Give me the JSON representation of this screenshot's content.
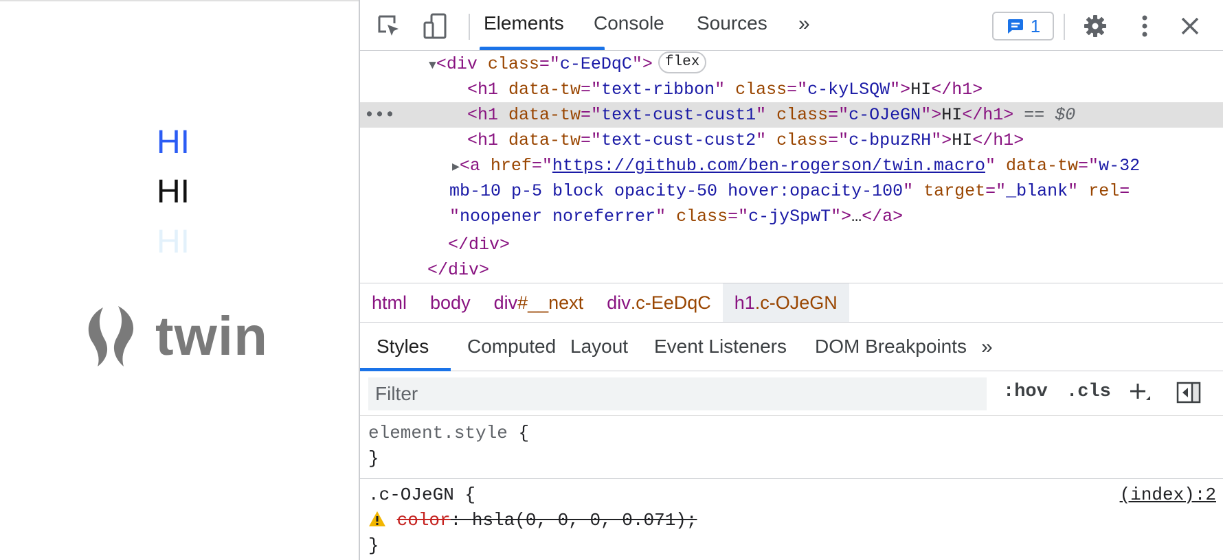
{
  "preview": {
    "hi_lines": [
      "HI",
      "HI",
      "HI"
    ],
    "logo_text": "twin",
    "colors": {
      "hi1": "#2b5cf4",
      "hi2": "#111111",
      "hi3": "#e3f1fb",
      "logo": "#7a7a7a"
    }
  },
  "devtools": {
    "tabs": [
      "Elements",
      "Console",
      "Sources"
    ],
    "more_tabs": "»",
    "issues_count": "1",
    "tree": {
      "div_open": {
        "tag": "div",
        "attr": "class",
        "value": "c-EeDqC",
        "badge": "flex"
      },
      "h1_ribbon": {
        "attr1": "data-tw",
        "val1": "text-ribbon",
        "attr2": "class",
        "val2": "c-kyLSQW",
        "text": "HI"
      },
      "h1_cust1": {
        "attr1": "data-tw",
        "val1": "text-cust-cust1",
        "attr2": "class",
        "val2": "c-OJeGN",
        "text": "HI",
        "suffix": "==",
        "dollar": "$0"
      },
      "h1_cust2": {
        "attr1": "data-tw",
        "val1": "text-cust-cust2",
        "attr2": "class",
        "val2": "c-bpuzRH",
        "text": "HI"
      },
      "anchor": {
        "href_attr": "href",
        "href": "https://github.com/ben-rogerson/twin.macro",
        "tw_attr": "data-tw",
        "tw_val_1": "w-32",
        "tw_val_2": "mb-10 p-5 block opacity-50 hover:opacity-100",
        "target_attr": "target",
        "target": "_blank",
        "rel_attr": "rel",
        "rel": "noopener noreferrer",
        "class_attr": "class",
        "class": "c-jySpwT",
        "ellipsis": "…"
      },
      "close_div_inner": "</div>",
      "close_div_outer": "</div>"
    },
    "breadcrumbs": [
      {
        "tag": "html",
        "cls": ""
      },
      {
        "tag": "body",
        "cls": ""
      },
      {
        "tag": "div",
        "cls": "#__next"
      },
      {
        "tag": "div",
        "cls": ".c-EeDqC"
      },
      {
        "tag": "h1",
        "cls": ".c-OJeGN"
      }
    ],
    "subtabs": [
      "Styles",
      "Computed",
      "Layout",
      "Event Listeners",
      "DOM Breakpoints"
    ],
    "filter_placeholder": "Filter",
    "hov": ":hov",
    "cls": ".cls",
    "styles": {
      "element_style": "element.style",
      "rule_selector": ".c-OJeGN",
      "prop": "color",
      "value": "hsla(0, 0, 0, 0.071);",
      "source": "(index):2"
    }
  }
}
